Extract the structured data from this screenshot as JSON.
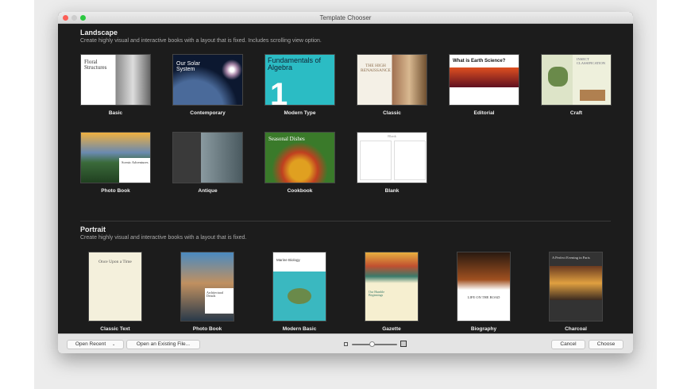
{
  "window": {
    "title": "Template Chooser"
  },
  "landscape": {
    "heading": "Landscape",
    "description": "Create highly visual and interactive books with a layout that is fixed. Includes scrolling view option.",
    "templates": [
      {
        "label": "Basic",
        "thumb_text": "Floral Structures"
      },
      {
        "label": "Contemporary",
        "thumb_text": "Our Solar System"
      },
      {
        "label": "Modern Type",
        "thumb_text": "Fundamentals of Algebra"
      },
      {
        "label": "Classic",
        "thumb_text": "THE HIGH RENAISSANCE"
      },
      {
        "label": "Editorial",
        "thumb_text": "What is Earth Science?"
      },
      {
        "label": "Craft",
        "thumb_text": "INSECT CLASSIFICATION"
      },
      {
        "label": "Photo Book",
        "thumb_text": "Scenic Adventures"
      },
      {
        "label": "Antique",
        "thumb_text": ""
      },
      {
        "label": "Cookbook",
        "thumb_text": "Seasonal Dishes"
      },
      {
        "label": "Blank",
        "thumb_text": "Blank"
      }
    ]
  },
  "portrait": {
    "heading": "Portrait",
    "description": "Create highly visual and interactive books with a layout that is fixed.",
    "templates": [
      {
        "label": "Classic Text",
        "thumb_text": "Once Upon a Time"
      },
      {
        "label": "Photo Book",
        "thumb_text": "Architectural Details"
      },
      {
        "label": "Modern Basic",
        "thumb_text": "Marine Biology"
      },
      {
        "label": "Gazette",
        "thumb_text": "Our Humble Beginnings"
      },
      {
        "label": "Biography",
        "thumb_text": "LIFE ON THE ROAD"
      },
      {
        "label": "Charcoal",
        "thumb_text": "A Perfect Evening in Paris"
      }
    ]
  },
  "footer": {
    "open_recent": "Open Recent",
    "open_existing": "Open an Existing File...",
    "cancel": "Cancel",
    "choose": "Choose",
    "zoom_level": 0.45
  }
}
